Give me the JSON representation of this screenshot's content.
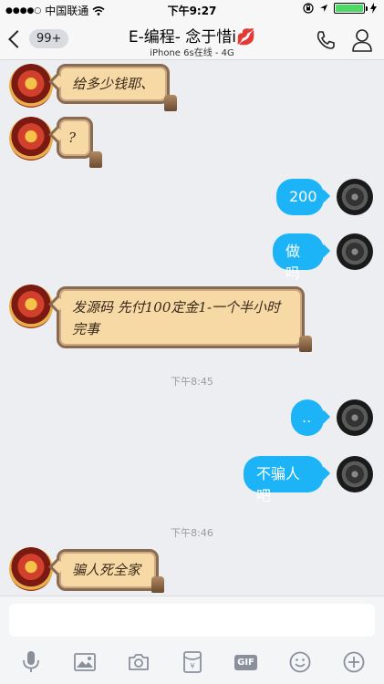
{
  "status": {
    "signal": "●●●●○",
    "carrier": "中国联通",
    "time": "下午9:27"
  },
  "nav": {
    "badge": "99+",
    "title": "E-编程- 念于惜i💋",
    "subtitle": "iPhone 6s在线 - 4G"
  },
  "messages": [
    {
      "side": "left",
      "text": "给多少钱耶、"
    },
    {
      "side": "left",
      "text": "?"
    },
    {
      "side": "right",
      "text": "200"
    },
    {
      "side": "right",
      "text": "做吗"
    },
    {
      "side": "left",
      "text": "发源码 先付100定金1-一个半小时完事"
    },
    {
      "side": "right",
      "text": ".."
    },
    {
      "side": "right",
      "text": "不骗人吧"
    },
    {
      "side": "left",
      "text": "骗人死全家"
    }
  ],
  "timestamps": [
    "下午8:45",
    "下午8:46"
  ],
  "input": {
    "placeholder": ""
  },
  "toolbar": {
    "icons": [
      "microphone-icon",
      "image-icon",
      "camera-icon",
      "red-packet-icon",
      "gif-icon",
      "emoji-icon",
      "plus-icon"
    ],
    "gif_label": "GIF"
  },
  "colors": {
    "accent": "#1CB4F6",
    "background": "#EDEEF2",
    "bubble_left": "#F7D9A6",
    "battery": "#4CD964"
  }
}
